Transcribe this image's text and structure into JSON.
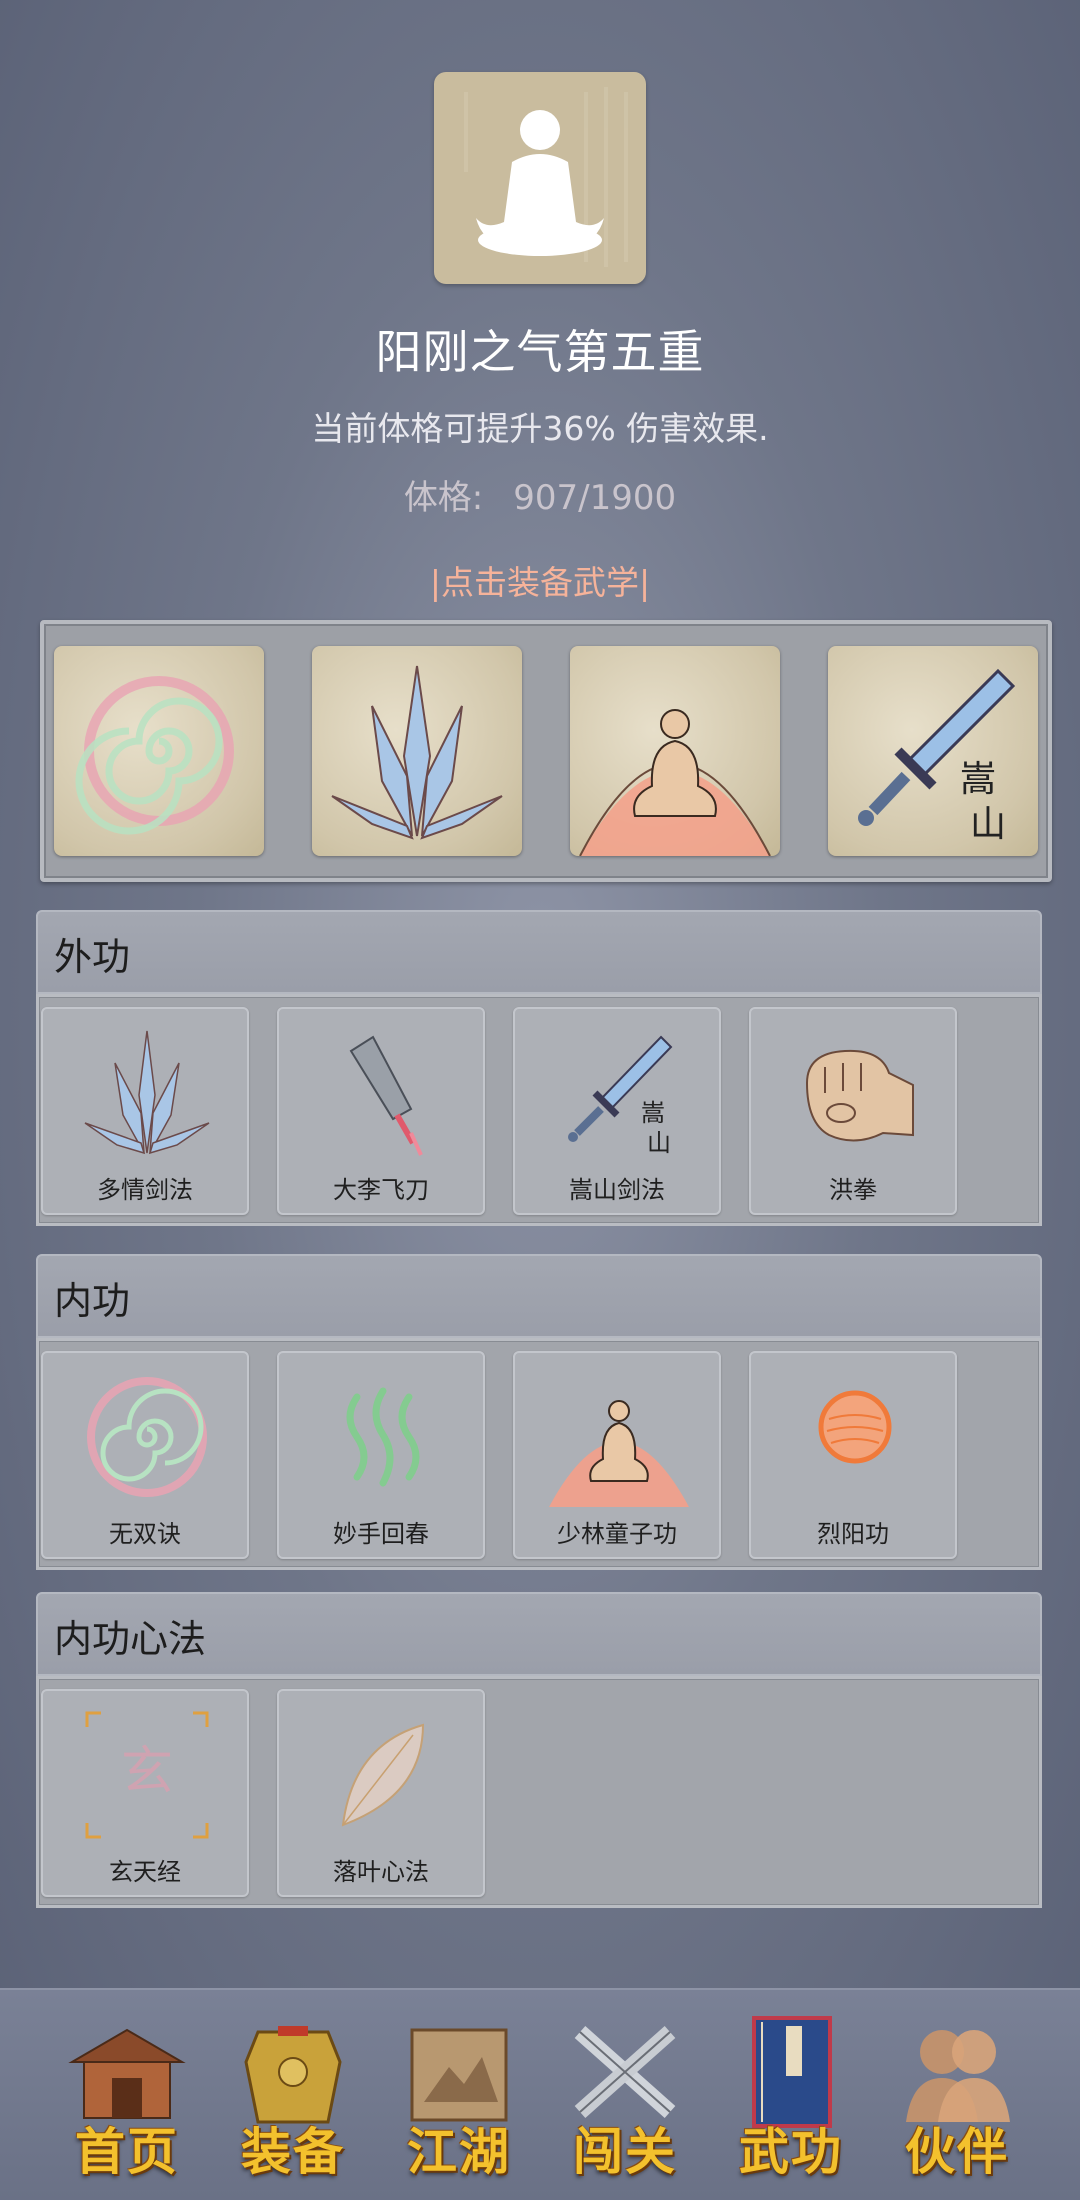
{
  "header": {
    "title": "阳刚之气第五重",
    "description": "当前体格可提升36% 伤害效果.",
    "physique_label": "体格:",
    "physique_value": "907/1900",
    "equip_hint": "|点击装备武学|"
  },
  "equipped": [
    {
      "icon": "spiral-icon"
    },
    {
      "icon": "blades-icon"
    },
    {
      "icon": "meditating-monk-icon"
    },
    {
      "icon": "songshan-sword-icon",
      "glyphs": [
        "嵩",
        "山"
      ]
    }
  ],
  "sections": {
    "external": {
      "title": "外功",
      "items": [
        {
          "label": "多情剑法",
          "icon": "blades-icon"
        },
        {
          "label": "大李飞刀",
          "icon": "flying-knife-icon"
        },
        {
          "label": "嵩山剑法",
          "icon": "songshan-sword-icon"
        },
        {
          "label": "洪拳",
          "icon": "fist-icon"
        }
      ]
    },
    "internal": {
      "title": "内功",
      "items": [
        {
          "label": "无双诀",
          "icon": "spiral-icon"
        },
        {
          "label": "妙手回春",
          "icon": "healing-waves-icon"
        },
        {
          "label": "少林童子功",
          "icon": "meditating-monk-icon"
        },
        {
          "label": "烈阳功",
          "icon": "sun-orb-icon"
        }
      ]
    },
    "mental": {
      "title": "内功心法",
      "items": [
        {
          "label": "玄天经",
          "icon": "xuan-scroll-icon",
          "glyph": "玄"
        },
        {
          "label": "落叶心法",
          "icon": "leaf-icon"
        }
      ]
    }
  },
  "nav": [
    {
      "label": "首页",
      "icon": "house-icon"
    },
    {
      "label": "装备",
      "icon": "armor-icon"
    },
    {
      "label": "江湖",
      "icon": "map-scroll-icon"
    },
    {
      "label": "闯关",
      "icon": "crossed-swords-icon"
    },
    {
      "label": "武功",
      "icon": "book-icon"
    },
    {
      "label": "伙伴",
      "icon": "partners-icon"
    }
  ],
  "colors": {
    "background": "#6f7689",
    "title": "#ffffff",
    "hint": "#f6b39a",
    "nav_label": "#f3c12d"
  }
}
